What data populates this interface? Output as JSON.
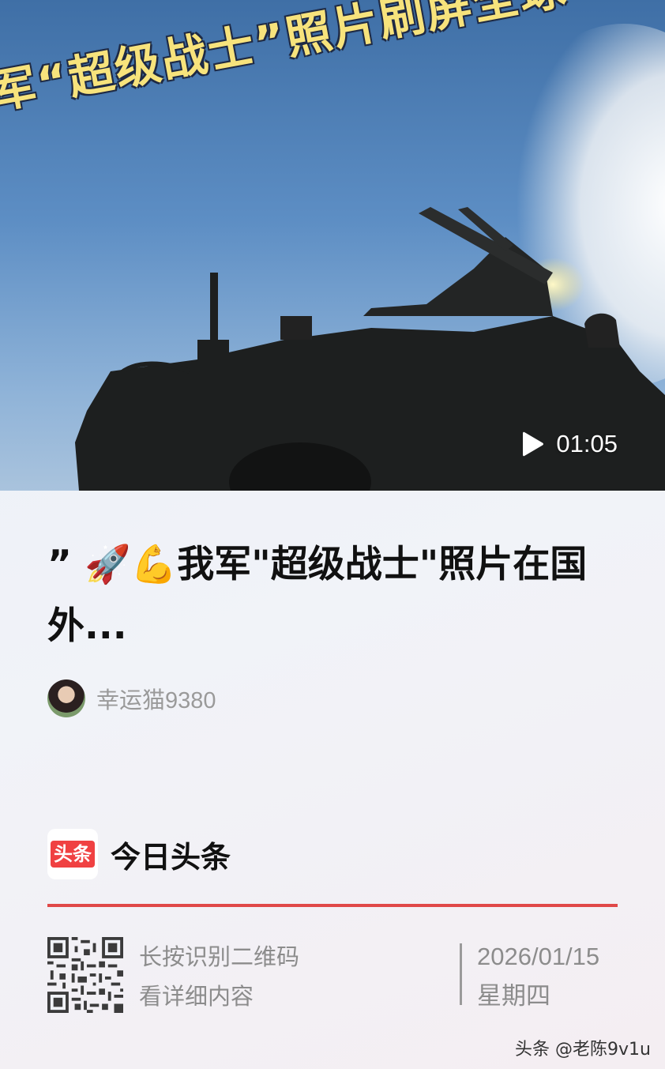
{
  "video": {
    "overlay_caption": "军“超级战士”照片刷屏全球",
    "duration": "01:05"
  },
  "article": {
    "title": "” 🚀💪我军\"超级战士\"照片在国外...",
    "author": "幸运猫9380"
  },
  "brand": {
    "logo_text": "头条",
    "name": "今日头条"
  },
  "footer": {
    "qr_line1": "长按识别二维码",
    "qr_line2": "看详细内容",
    "date": "2026/01/15",
    "weekday": "星期四"
  },
  "watermark": "头条 @老陈9v1u",
  "colors": {
    "accent": "#e04848",
    "logo_red": "#f04142",
    "caption_yellow": "#f7e37c"
  },
  "icons": [
    "play-icon",
    "qr-code"
  ]
}
